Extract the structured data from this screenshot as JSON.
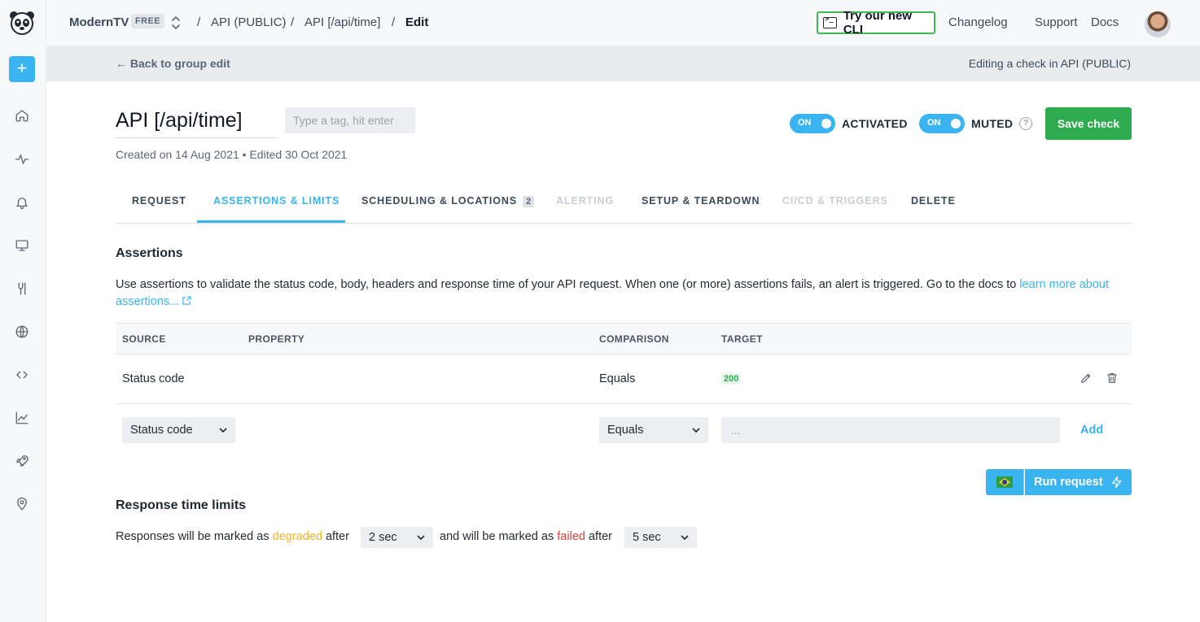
{
  "app": {
    "account": "ModernTV",
    "plan": "FREE",
    "brand_color": "#39b4f0",
    "success_color": "#2eaa4f"
  },
  "breadcrumb": {
    "items": [
      "API (PUBLIC)",
      "API [/api/time]",
      "Edit"
    ],
    "separator": "/"
  },
  "topnav": {
    "cli_label": "Try our new CLI",
    "changelog": "Changelog",
    "support": "Support",
    "docs": "Docs"
  },
  "sidebar": {
    "add_label": "+",
    "icons": [
      "home-icon",
      "activity-icon",
      "bell-icon",
      "monitor-icon",
      "tools-icon",
      "globe-icon",
      "code-icon",
      "chart-icon",
      "rocket-icon",
      "location-pin-icon"
    ]
  },
  "subheader": {
    "back_label": "← Back to group edit",
    "context": "Editing a check in API (PUBLIC)"
  },
  "check": {
    "name": "API [/api/time]",
    "tag_placeholder": "Type a tag, hit enter",
    "meta": "Created on 14 Aug 2021 • Edited 30 Oct 2021",
    "activated": {
      "state": "ON",
      "label": "ACTIVATED"
    },
    "muted": {
      "state": "ON",
      "label": "MUTED"
    },
    "help": "?",
    "save_label": "Save check"
  },
  "tabs": [
    {
      "label": "REQUEST",
      "state": "normal"
    },
    {
      "label": "ASSERTIONS & LIMITS",
      "state": "active"
    },
    {
      "label": "SCHEDULING & LOCATIONS",
      "state": "normal",
      "count": "2"
    },
    {
      "label": "ALERTING",
      "state": "disabled"
    },
    {
      "label": "SETUP & TEARDOWN",
      "state": "normal"
    },
    {
      "label": "CI/CD & TRIGGERS",
      "state": "disabled"
    },
    {
      "label": "DELETE",
      "state": "normal"
    }
  ],
  "assertions": {
    "title": "Assertions",
    "description": "Use assertions to validate the status code, body, headers and response time of your API request. When one (or more) assertions fails, an alert is triggered. Go to the docs to ",
    "link_text": "learn more about assertions...",
    "columns": [
      "SOURCE",
      "PROPERTY",
      "COMPARISON",
      "TARGET"
    ],
    "rows": [
      {
        "source": "Status code",
        "property": "",
        "comparison": "Equals",
        "target": "200"
      }
    ],
    "new_row": {
      "source": "Status code",
      "comparison": "Equals",
      "target_placeholder": "...",
      "add_label": "Add"
    }
  },
  "run": {
    "location_flag": "brazil-flag-icon",
    "label": "Run request"
  },
  "limits": {
    "title": "Response time limits",
    "text_1": "Responses will be marked as",
    "degraded_word": "degraded",
    "text_2": "after",
    "degraded_value": "2 sec",
    "text_3": "and will be marked as",
    "failed_word": "failed",
    "text_4": "after",
    "failed_value": "5 sec"
  }
}
